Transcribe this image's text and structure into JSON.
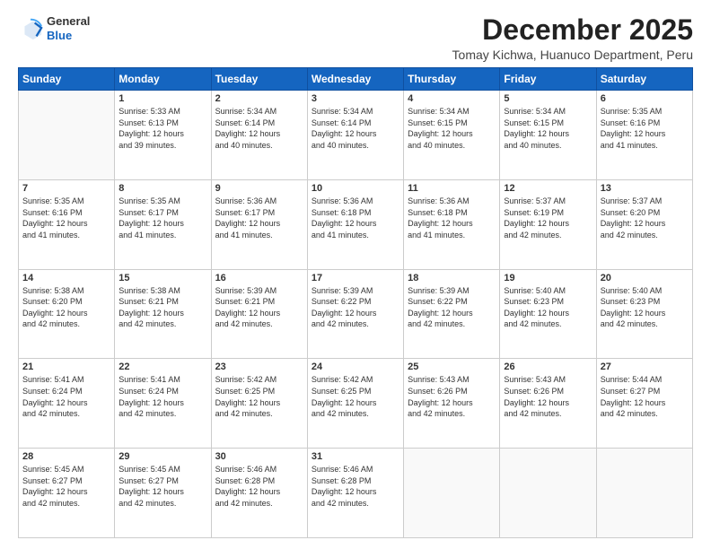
{
  "logo": {
    "general": "General",
    "blue": "Blue"
  },
  "header": {
    "title": "December 2025",
    "subtitle": "Tomay Kichwa, Huanuco Department, Peru"
  },
  "weekdays": [
    "Sunday",
    "Monday",
    "Tuesday",
    "Wednesday",
    "Thursday",
    "Friday",
    "Saturday"
  ],
  "weeks": [
    [
      {
        "day": "",
        "info": ""
      },
      {
        "day": "1",
        "info": "Sunrise: 5:33 AM\nSunset: 6:13 PM\nDaylight: 12 hours\nand 39 minutes."
      },
      {
        "day": "2",
        "info": "Sunrise: 5:34 AM\nSunset: 6:14 PM\nDaylight: 12 hours\nand 40 minutes."
      },
      {
        "day": "3",
        "info": "Sunrise: 5:34 AM\nSunset: 6:14 PM\nDaylight: 12 hours\nand 40 minutes."
      },
      {
        "day": "4",
        "info": "Sunrise: 5:34 AM\nSunset: 6:15 PM\nDaylight: 12 hours\nand 40 minutes."
      },
      {
        "day": "5",
        "info": "Sunrise: 5:34 AM\nSunset: 6:15 PM\nDaylight: 12 hours\nand 40 minutes."
      },
      {
        "day": "6",
        "info": "Sunrise: 5:35 AM\nSunset: 6:16 PM\nDaylight: 12 hours\nand 41 minutes."
      }
    ],
    [
      {
        "day": "7",
        "info": "Sunrise: 5:35 AM\nSunset: 6:16 PM\nDaylight: 12 hours\nand 41 minutes."
      },
      {
        "day": "8",
        "info": "Sunrise: 5:35 AM\nSunset: 6:17 PM\nDaylight: 12 hours\nand 41 minutes."
      },
      {
        "day": "9",
        "info": "Sunrise: 5:36 AM\nSunset: 6:17 PM\nDaylight: 12 hours\nand 41 minutes."
      },
      {
        "day": "10",
        "info": "Sunrise: 5:36 AM\nSunset: 6:18 PM\nDaylight: 12 hours\nand 41 minutes."
      },
      {
        "day": "11",
        "info": "Sunrise: 5:36 AM\nSunset: 6:18 PM\nDaylight: 12 hours\nand 41 minutes."
      },
      {
        "day": "12",
        "info": "Sunrise: 5:37 AM\nSunset: 6:19 PM\nDaylight: 12 hours\nand 42 minutes."
      },
      {
        "day": "13",
        "info": "Sunrise: 5:37 AM\nSunset: 6:20 PM\nDaylight: 12 hours\nand 42 minutes."
      }
    ],
    [
      {
        "day": "14",
        "info": "Sunrise: 5:38 AM\nSunset: 6:20 PM\nDaylight: 12 hours\nand 42 minutes."
      },
      {
        "day": "15",
        "info": "Sunrise: 5:38 AM\nSunset: 6:21 PM\nDaylight: 12 hours\nand 42 minutes."
      },
      {
        "day": "16",
        "info": "Sunrise: 5:39 AM\nSunset: 6:21 PM\nDaylight: 12 hours\nand 42 minutes."
      },
      {
        "day": "17",
        "info": "Sunrise: 5:39 AM\nSunset: 6:22 PM\nDaylight: 12 hours\nand 42 minutes."
      },
      {
        "day": "18",
        "info": "Sunrise: 5:39 AM\nSunset: 6:22 PM\nDaylight: 12 hours\nand 42 minutes."
      },
      {
        "day": "19",
        "info": "Sunrise: 5:40 AM\nSunset: 6:23 PM\nDaylight: 12 hours\nand 42 minutes."
      },
      {
        "day": "20",
        "info": "Sunrise: 5:40 AM\nSunset: 6:23 PM\nDaylight: 12 hours\nand 42 minutes."
      }
    ],
    [
      {
        "day": "21",
        "info": "Sunrise: 5:41 AM\nSunset: 6:24 PM\nDaylight: 12 hours\nand 42 minutes."
      },
      {
        "day": "22",
        "info": "Sunrise: 5:41 AM\nSunset: 6:24 PM\nDaylight: 12 hours\nand 42 minutes."
      },
      {
        "day": "23",
        "info": "Sunrise: 5:42 AM\nSunset: 6:25 PM\nDaylight: 12 hours\nand 42 minutes."
      },
      {
        "day": "24",
        "info": "Sunrise: 5:42 AM\nSunset: 6:25 PM\nDaylight: 12 hours\nand 42 minutes."
      },
      {
        "day": "25",
        "info": "Sunrise: 5:43 AM\nSunset: 6:26 PM\nDaylight: 12 hours\nand 42 minutes."
      },
      {
        "day": "26",
        "info": "Sunrise: 5:43 AM\nSunset: 6:26 PM\nDaylight: 12 hours\nand 42 minutes."
      },
      {
        "day": "27",
        "info": "Sunrise: 5:44 AM\nSunset: 6:27 PM\nDaylight: 12 hours\nand 42 minutes."
      }
    ],
    [
      {
        "day": "28",
        "info": "Sunrise: 5:45 AM\nSunset: 6:27 PM\nDaylight: 12 hours\nand 42 minutes."
      },
      {
        "day": "29",
        "info": "Sunrise: 5:45 AM\nSunset: 6:27 PM\nDaylight: 12 hours\nand 42 minutes."
      },
      {
        "day": "30",
        "info": "Sunrise: 5:46 AM\nSunset: 6:28 PM\nDaylight: 12 hours\nand 42 minutes."
      },
      {
        "day": "31",
        "info": "Sunrise: 5:46 AM\nSunset: 6:28 PM\nDaylight: 12 hours\nand 42 minutes."
      },
      {
        "day": "",
        "info": ""
      },
      {
        "day": "",
        "info": ""
      },
      {
        "day": "",
        "info": ""
      }
    ]
  ]
}
